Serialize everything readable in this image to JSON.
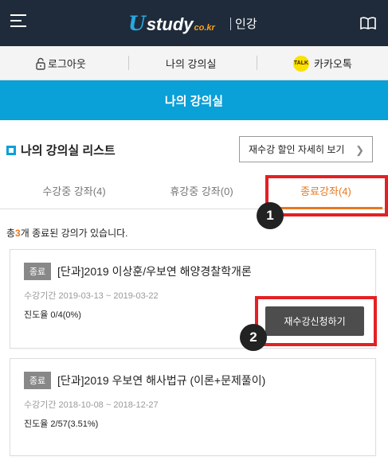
{
  "header": {
    "menu_icon": "hamburger-menu-icon",
    "logo_u": "U",
    "logo_main": "study",
    "logo_sub": "co.kr",
    "logo_tag": "인강",
    "book_icon": "book-icon"
  },
  "utility": {
    "logout": "로그아웃",
    "my_room": "나의 강의실",
    "kakao": "카카오톡",
    "kakao_icon_text": "TALK"
  },
  "banner": {
    "title": "나의 강의실"
  },
  "list": {
    "title": "나의 강의실 리스트",
    "discount_button": "재수강 할인 자세히 보기"
  },
  "tabs": [
    {
      "label": "수강중 강좌(4)",
      "active": false
    },
    {
      "label": "휴강중 강좌(0)",
      "active": false
    },
    {
      "label": "종료강좌(4)",
      "active": true
    }
  ],
  "summary": {
    "prefix": "총",
    "count": "3",
    "suffix": "개 종료된 강의가 있습니다."
  },
  "courses": [
    {
      "status": "종료",
      "title": "[단과]2019 이상훈/우보연 해양경찰학개론",
      "period": "수강기간 2019-03-13 ~ 2019-03-22",
      "progress": "진도율 0/4(0%)",
      "retake_button": "재수강신청하기"
    },
    {
      "status": "종료",
      "title": "[단과]2019 우보연 해사법규 (이론+문제풀이)",
      "period": "수강기간 2018-10-08 ~ 2018-12-27",
      "progress": "진도율 2/57(3.51%)"
    }
  ],
  "annotations": {
    "badge1": "1",
    "badge2": "2"
  },
  "colors": {
    "header_bg": "#1f2b3a",
    "banner_bg": "#0aa0d8",
    "accent_orange": "#e8781e",
    "highlight_red": "#e42024",
    "kakao_yellow": "#fae100"
  }
}
